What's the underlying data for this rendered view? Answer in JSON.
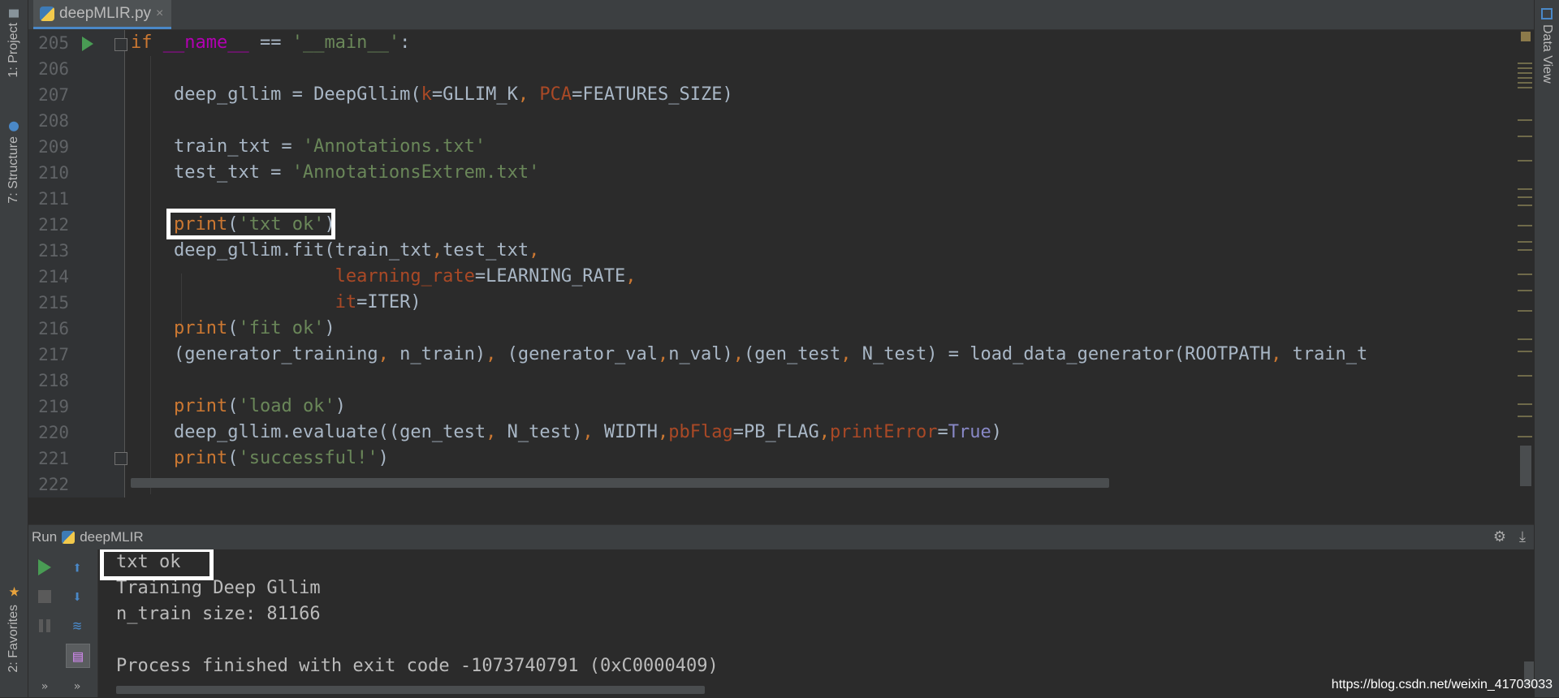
{
  "tab": {
    "filename": "deepMLIR.py",
    "close": "×"
  },
  "left_stripe": {
    "project": "1: Project",
    "structure": "7: Structure",
    "favorites": "2: Favorites"
  },
  "right_stripe": {
    "data_view": "Data View"
  },
  "editor": {
    "lines": [
      {
        "num": "205",
        "segments": [
          [
            "kw",
            "if "
          ],
          [
            "plain",
            ""
          ],
          [
            "dunder",
            "__name__"
          ],
          [
            "plain",
            " == "
          ],
          [
            "str",
            "'__main__'"
          ],
          [
            "plain",
            ":"
          ]
        ]
      },
      {
        "num": "206",
        "segments": []
      },
      {
        "num": "207",
        "segments": [
          [
            "plain",
            "    deep_gllim = DeepGllim("
          ],
          [
            "param",
            "k"
          ],
          [
            "plain",
            "=GLLIM_K"
          ],
          [
            "kw",
            ", "
          ],
          [
            "param",
            "PCA"
          ],
          [
            "plain",
            "=FEATURES_SIZE)"
          ]
        ]
      },
      {
        "num": "208",
        "segments": []
      },
      {
        "num": "209",
        "segments": [
          [
            "plain",
            "    train_txt = "
          ],
          [
            "str",
            "'Annotations.txt'"
          ]
        ]
      },
      {
        "num": "210",
        "segments": [
          [
            "plain",
            "    test_txt = "
          ],
          [
            "str",
            "'AnnotationsExtrem.txt'"
          ]
        ]
      },
      {
        "num": "211",
        "segments": []
      },
      {
        "num": "212",
        "segments": [
          [
            "plain",
            "    "
          ],
          [
            "kw",
            "print"
          ],
          [
            "plain",
            "("
          ],
          [
            "str",
            "'txt ok'"
          ],
          [
            "plain",
            ")"
          ]
        ]
      },
      {
        "num": "213",
        "segments": [
          [
            "plain",
            "    deep_gllim.fit(train_txt"
          ],
          [
            "kw",
            ","
          ],
          [
            "plain",
            "test_txt"
          ],
          [
            "kw",
            ","
          ]
        ]
      },
      {
        "num": "214",
        "segments": [
          [
            "plain",
            "                   "
          ],
          [
            "param",
            "learning_rate"
          ],
          [
            "plain",
            "=LEARNING_RATE"
          ],
          [
            "kw",
            ","
          ]
        ]
      },
      {
        "num": "215",
        "segments": [
          [
            "plain",
            "                   "
          ],
          [
            "param",
            "it"
          ],
          [
            "plain",
            "=ITER)"
          ]
        ]
      },
      {
        "num": "216",
        "segments": [
          [
            "plain",
            "    "
          ],
          [
            "kw",
            "print"
          ],
          [
            "plain",
            "("
          ],
          [
            "str",
            "'fit ok'"
          ],
          [
            "plain",
            ")"
          ]
        ]
      },
      {
        "num": "217",
        "segments": [
          [
            "plain",
            "    (generator_training"
          ],
          [
            "kw",
            ", "
          ],
          [
            "plain",
            "n_train)"
          ],
          [
            "kw",
            ", "
          ],
          [
            "plain",
            "(generator_val"
          ],
          [
            "kw",
            ","
          ],
          [
            "plain",
            "n_val)"
          ],
          [
            "kw",
            ","
          ],
          [
            "plain",
            "(gen_test"
          ],
          [
            "kw",
            ", "
          ],
          [
            "plain",
            "N_test) = load_data_generator(ROOTPATH"
          ],
          [
            "kw",
            ", "
          ],
          [
            "plain",
            "train_t"
          ]
        ]
      },
      {
        "num": "218",
        "segments": []
      },
      {
        "num": "219",
        "segments": [
          [
            "plain",
            "    "
          ],
          [
            "kw",
            "print"
          ],
          [
            "plain",
            "("
          ],
          [
            "str",
            "'load ok'"
          ],
          [
            "plain",
            ")"
          ]
        ]
      },
      {
        "num": "220",
        "segments": [
          [
            "plain",
            "    deep_gllim.evaluate((gen_test"
          ],
          [
            "kw",
            ", "
          ],
          [
            "plain",
            "N_test)"
          ],
          [
            "kw",
            ", "
          ],
          [
            "plain",
            "WIDTH"
          ],
          [
            "kw",
            ","
          ],
          [
            "param",
            "pbFlag"
          ],
          [
            "plain",
            "=PB_FLAG"
          ],
          [
            "kw",
            ","
          ],
          [
            "param",
            "printError"
          ],
          [
            "plain",
            "="
          ],
          [
            "special",
            "True"
          ],
          [
            "plain",
            ")"
          ]
        ]
      },
      {
        "num": "221",
        "segments": [
          [
            "plain",
            "    "
          ],
          [
            "kw",
            "print"
          ],
          [
            "plain",
            "("
          ],
          [
            "str",
            "'successful!'"
          ],
          [
            "plain",
            ")"
          ]
        ]
      },
      {
        "num": "222",
        "segments": []
      }
    ]
  },
  "run_panel": {
    "label": "Run",
    "config": "deepMLIR",
    "settings_icon": "⚙",
    "pin_icon": "⤓"
  },
  "console": {
    "lines": [
      "txt ok",
      "Training Deep Gllim",
      "n_train size: 81166",
      "",
      "Process finished with exit code -1073740791 (0xC0000409)"
    ]
  },
  "watermark": "https://blog.csdn.net/weixin_41703033",
  "colors": {
    "keyword": "#cc7832",
    "string": "#6a8759",
    "param": "#aa4926",
    "run_green": "#499c54",
    "tab_accent": "#4a88c7"
  },
  "icons": [
    "python-file-icon",
    "run-icon",
    "stop-icon",
    "pause-icon",
    "up-arrow-icon",
    "down-arrow-icon",
    "soft-wrap-icon",
    "scroll-to-end-icon",
    "gear-icon",
    "pin-icon",
    "star-icon",
    "table-icon"
  ]
}
